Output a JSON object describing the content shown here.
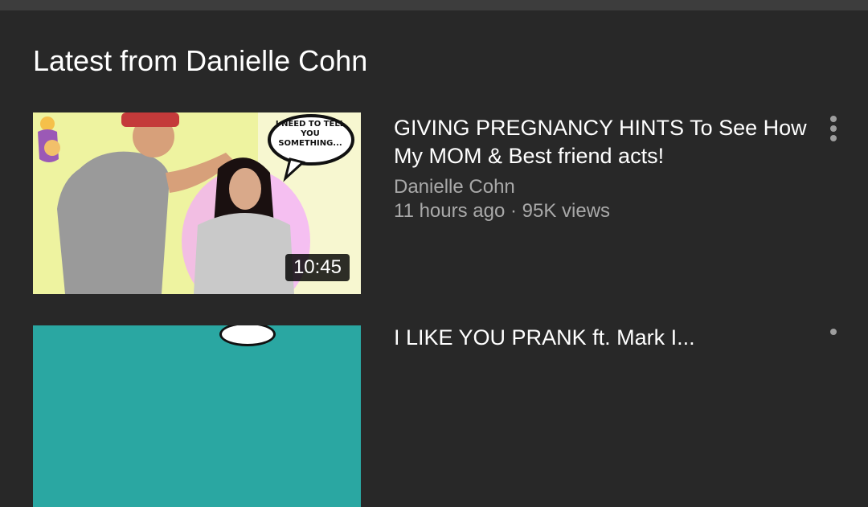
{
  "section": {
    "title": "Latest from Danielle Cohn"
  },
  "videos": [
    {
      "title": "GIVING PREGNANCY HINTS To See How My MOM & Best friend acts!",
      "channel": "Danielle Cohn",
      "stats": "11 hours ago · 95K views",
      "duration": "10:45",
      "thumbnail": {
        "speech_bubble": "I NEED TO TELL YOU SOMETHING...",
        "emoji": "pregnant-woman-emoji"
      }
    },
    {
      "title": "I LIKE YOU PRANK ft. Mark I..."
    }
  ],
  "icons": {
    "more": "more-vertical-icon"
  },
  "colors": {
    "background": "#282828",
    "title": "#ffffff",
    "secondary_text": "#a9a9a9",
    "topbar": "#3d3d3d"
  }
}
